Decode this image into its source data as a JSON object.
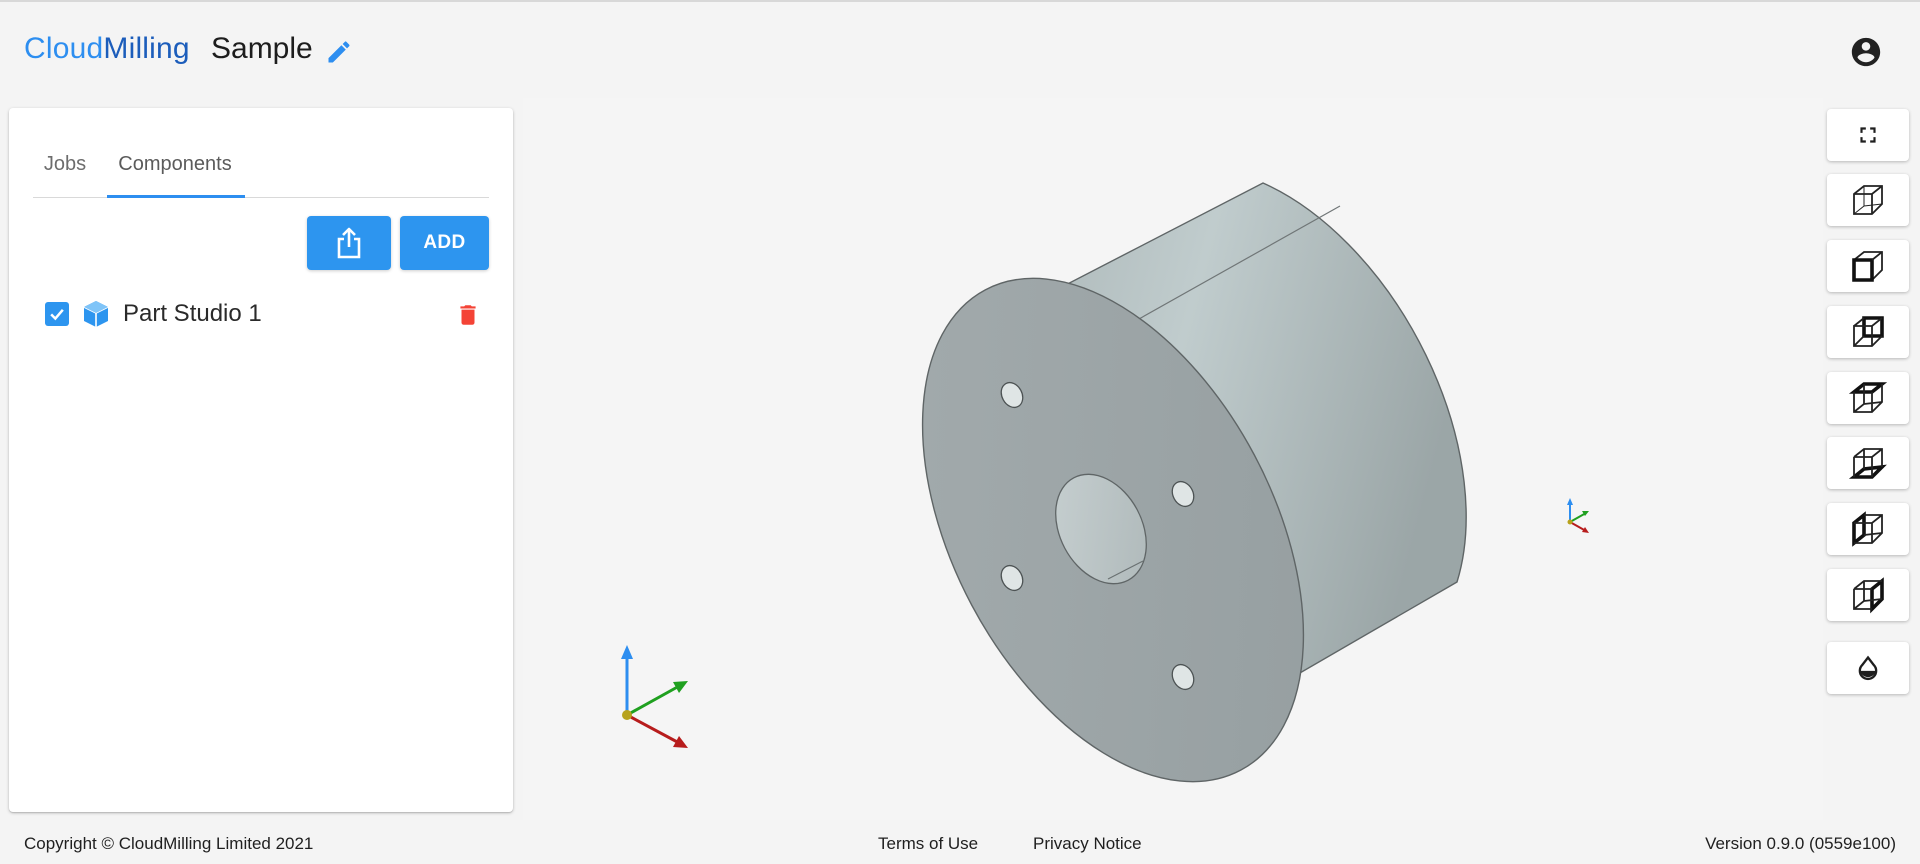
{
  "header": {
    "brand_part1": "Cloud",
    "brand_part2": "Milling",
    "project_title": "Sample"
  },
  "sidebar": {
    "tabs": [
      {
        "label": "Jobs",
        "active": false
      },
      {
        "label": "Components",
        "active": true
      }
    ],
    "add_label": "ADD",
    "components": [
      {
        "name": "Part Studio 1",
        "checked": true
      }
    ]
  },
  "viewer": {
    "view_buttons": [
      "fullscreen-icon",
      "view-cube-iso-icon",
      "view-cube-front-icon",
      "view-cube-back-icon",
      "view-cube-top-icon",
      "view-cube-bottom-icon",
      "view-cube-left-icon",
      "view-cube-right-icon",
      "shading-icon"
    ]
  },
  "footer": {
    "copyright": "Copyright © CloudMilling Limited 2021",
    "terms": "Terms of Use",
    "privacy": "Privacy Notice",
    "version": "Version 0.9.0 (0559e100)"
  },
  "colors": {
    "accent": "#2d95ef",
    "brand_dark": "#1c5dbb",
    "delete": "#f44336",
    "axis_x": "#b71c1c",
    "axis_y": "#1fa01f",
    "axis_z": "#2d8ef0"
  }
}
